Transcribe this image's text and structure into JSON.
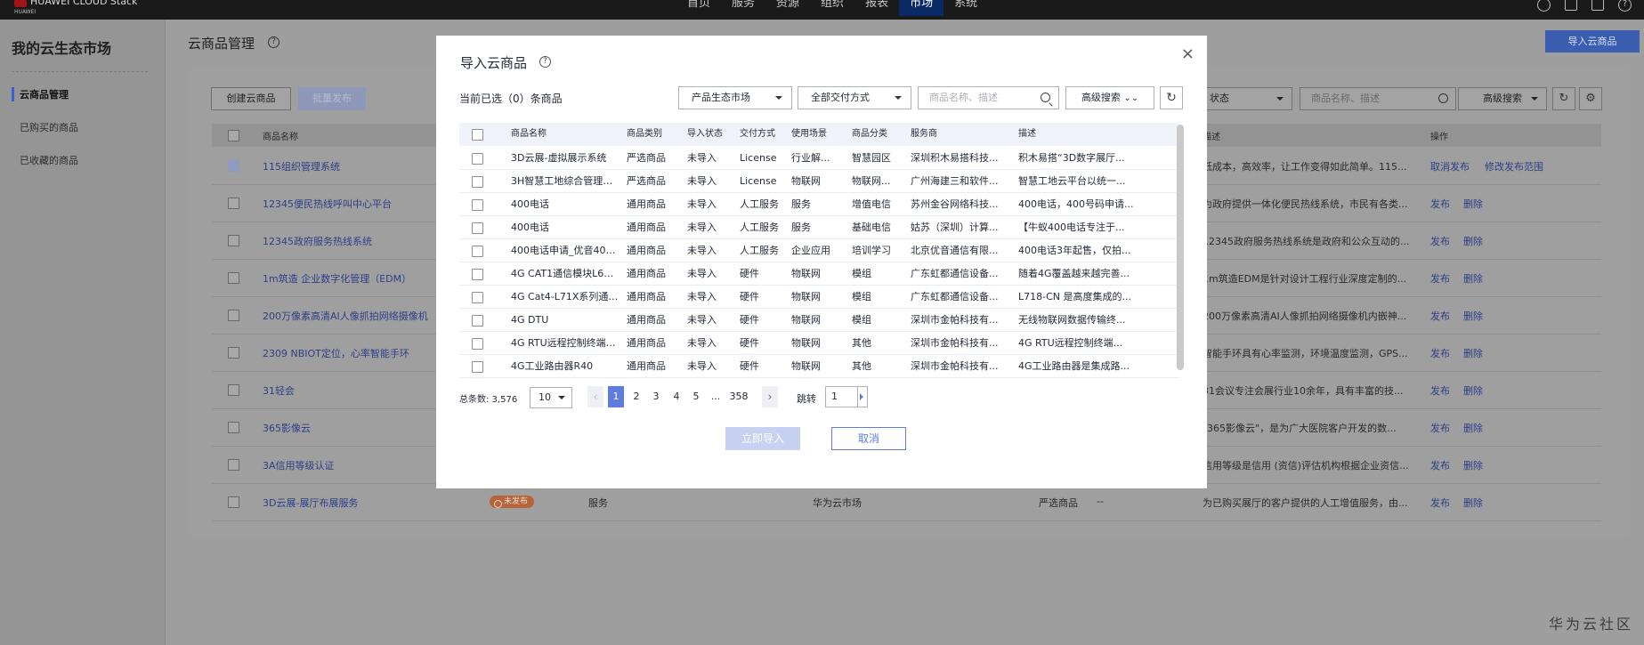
{
  "topbar": {
    "brand": "HUAWEI CLOUD Stack",
    "brand_sub": "HUAWEI",
    "nav": [
      "首页",
      "服务",
      "资源",
      "组织",
      "报表",
      "市场",
      "系统"
    ],
    "active_nav": "市场"
  },
  "sidebar": {
    "title": "我的云生态市场",
    "items": [
      {
        "label": "云商品管理",
        "active": true
      },
      {
        "label": "已购买的商品",
        "active": false
      },
      {
        "label": "已收藏的商品",
        "active": false
      }
    ]
  },
  "page": {
    "title": "云商品管理",
    "import_button": "导入云商品",
    "create_button": "创建云商品",
    "batch_publish_button": "批量发布",
    "status_filter": "状态",
    "search_placeholder": "商品名称、描述",
    "advanced_search": "高级搜索",
    "table_headers": {
      "name": "商品名称",
      "desc": "描述",
      "ops": "操作"
    },
    "rows": [
      {
        "name": "115组织管理系统",
        "desc": "低成本，高效率，让工作变得如此简单。115...",
        "ops": [
          "取消发布",
          "修改发布范围"
        ]
      },
      {
        "name": "12345便民热线呼叫中心平台",
        "desc": "为政府提供一体化便民热线系统，市民有各类...",
        "ops": [
          "发布",
          "删除"
        ]
      },
      {
        "name": "12345政府服务热线系统",
        "desc": "12345政府服务热线系统是政府和公众互动的...",
        "ops": [
          "发布",
          "删除"
        ]
      },
      {
        "name": "1m筑造 企业数字化管理（EDM）",
        "desc": "1m筑造EDM是针对设计工程行业深度定制的...",
        "ops": [
          "发布",
          "删除"
        ]
      },
      {
        "name": "200万像素高清AI人像抓拍网络摄像机",
        "desc": "200万像素高清AI人像抓拍网络摄像机内嵌神...",
        "ops": [
          "发布",
          "删除"
        ]
      },
      {
        "name": "2309 NBIOT定位，心率智能手环",
        "desc": "智能手环具有心率监测，环境温度监测，GPS...",
        "ops": [
          "发布",
          "删除"
        ]
      },
      {
        "name": "31轻会",
        "desc": "31会议专注会展行业10余年，具有丰富的技...",
        "ops": [
          "发布",
          "删除"
        ]
      },
      {
        "name": "365影像云",
        "desc": "\"365影像云\"，是为广大医院客户开发的数...",
        "ops": [
          "发布",
          "删除"
        ]
      },
      {
        "name": "3A信用等级认证",
        "desc": "信用等级是信用 (资信)评估机构根据企业资信...",
        "ops": [
          "发布",
          "删除"
        ]
      },
      {
        "name": "3D云展-展厅布展服务",
        "desc": "为已购买展厅的客户提供的人工增值服务，由...",
        "ops": [
          "发布",
          "删除"
        ],
        "status": "未发布",
        "type": "服务",
        "market": "华为云市场",
        "category": "严选商品",
        "dash": "--"
      }
    ]
  },
  "watermark": "华为云社区",
  "modal": {
    "title": "导入云商品",
    "selected_text": "当前已选（0）条商品",
    "filter_market": "产品生态市场",
    "filter_delivery": "全部交付方式",
    "search_placeholder": "商品名称、描述",
    "advanced_search": "高级搜索",
    "headers": [
      "商品名称",
      "商品类别",
      "导入状态",
      "交付方式",
      "使用场景",
      "商品分类",
      "服务商",
      "描述"
    ],
    "rows": [
      [
        "3D云展-虚拟展示系统",
        "严选商品",
        "未导入",
        "License",
        "行业解...",
        "智慧园区",
        "深圳积木易搭科技...",
        "积木易搭“3D数字展厅..."
      ],
      [
        "3H智慧工地综合管理信...",
        "严选商品",
        "未导入",
        "License",
        "物联网",
        "物联网...",
        "广州海建三和软件...",
        "智慧工地云平台以统一..."
      ],
      [
        "400电话",
        "通用商品",
        "未导入",
        "人工服务",
        "服务",
        "增值电信",
        "苏州金谷网络科技...",
        "400电话，400号码申请..."
      ],
      [
        "400电话",
        "通用商品",
        "未导入",
        "人工服务",
        "服务",
        "基础电信",
        "姑苏（深圳）计算...",
        "【牛蚁400电话专注于..."
      ],
      [
        "400电话申请_优音400电...",
        "通用商品",
        "未导入",
        "人工服务",
        "企业应用",
        "培训学习",
        "北京优音通信有限...",
        "400电话3年起售，仅拍..."
      ],
      [
        "4G CAT1通信模块L610 ...",
        "通用商品",
        "未导入",
        "硬件",
        "物联网",
        "模组",
        "广东虹都通信设备...",
        "随着4G覆盖越来越完善..."
      ],
      [
        "4G Cat4-L71X系列通信...",
        "通用商品",
        "未导入",
        "硬件",
        "物联网",
        "模组",
        "广东虹都通信设备...",
        "L718-CN 是高度集成的..."
      ],
      [
        "4G DTU",
        "通用商品",
        "未导入",
        "硬件",
        "物联网",
        "模组",
        "深圳市金帕科技有...",
        "无线物联网数据传输终..."
      ],
      [
        "4G RTU远程控制终端S270",
        "通用商品",
        "未导入",
        "硬件",
        "物联网",
        "其他",
        "深圳市金帕科技有...",
        "4G RTU远程控制终端..."
      ],
      [
        "4G工业路由器R40",
        "通用商品",
        "未导入",
        "硬件",
        "物联网",
        "其他",
        "深圳市金帕科技有...",
        "4G工业路由器是集成路..."
      ]
    ],
    "pagination": {
      "total_label": "总条数: 3,576",
      "page_size": "10",
      "pages": [
        "1",
        "2",
        "3",
        "4",
        "5",
        "...",
        "358"
      ],
      "current": "1",
      "jump_label": "跳转",
      "jump_value": "1",
      "prev": "‹",
      "next": "›"
    },
    "confirm_button": "立即导入",
    "cancel_button": "取消",
    "close": "×",
    "help": "?"
  }
}
